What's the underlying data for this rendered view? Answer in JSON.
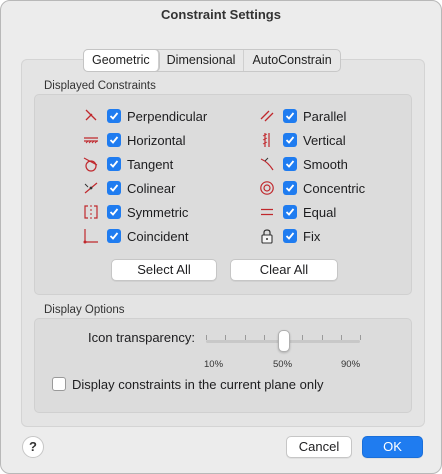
{
  "window": {
    "title": "Constraint Settings"
  },
  "tabs": [
    {
      "label": "Geometric",
      "active": true
    },
    {
      "label": "Dimensional",
      "active": false
    },
    {
      "label": "AutoConstrain",
      "active": false
    }
  ],
  "displayed_constraints": {
    "heading": "Displayed Constraints",
    "left": [
      {
        "label": "Perpendicular",
        "checked": true,
        "icon": "perpendicular-icon"
      },
      {
        "label": "Horizontal",
        "checked": true,
        "icon": "horizontal-icon"
      },
      {
        "label": "Tangent",
        "checked": true,
        "icon": "tangent-icon"
      },
      {
        "label": "Colinear",
        "checked": true,
        "icon": "colinear-icon"
      },
      {
        "label": "Symmetric",
        "checked": true,
        "icon": "symmetric-icon"
      },
      {
        "label": "Coincident",
        "checked": true,
        "icon": "coincident-icon"
      }
    ],
    "right": [
      {
        "label": "Parallel",
        "checked": true,
        "icon": "parallel-icon"
      },
      {
        "label": "Vertical",
        "checked": true,
        "icon": "vertical-icon"
      },
      {
        "label": "Smooth",
        "checked": true,
        "icon": "smooth-icon"
      },
      {
        "label": "Concentric",
        "checked": true,
        "icon": "concentric-icon"
      },
      {
        "label": "Equal",
        "checked": true,
        "icon": "equal-icon"
      },
      {
        "label": "Fix",
        "checked": true,
        "icon": "lock-icon"
      }
    ],
    "select_all_label": "Select All",
    "clear_all_label": "Clear All"
  },
  "display_options": {
    "heading": "Display Options",
    "transparency_label": "Icon transparency:",
    "transparency_value": 0.5,
    "tick_labels": [
      "10%",
      "50%",
      "90%"
    ],
    "current_plane_label": "Display constraints in the current plane only",
    "current_plane_checked": false
  },
  "footer": {
    "help_label": "?",
    "cancel_label": "Cancel",
    "ok_label": "OK"
  },
  "colors": {
    "accent": "#1f7cf0",
    "icon_red": "#c0282d"
  }
}
